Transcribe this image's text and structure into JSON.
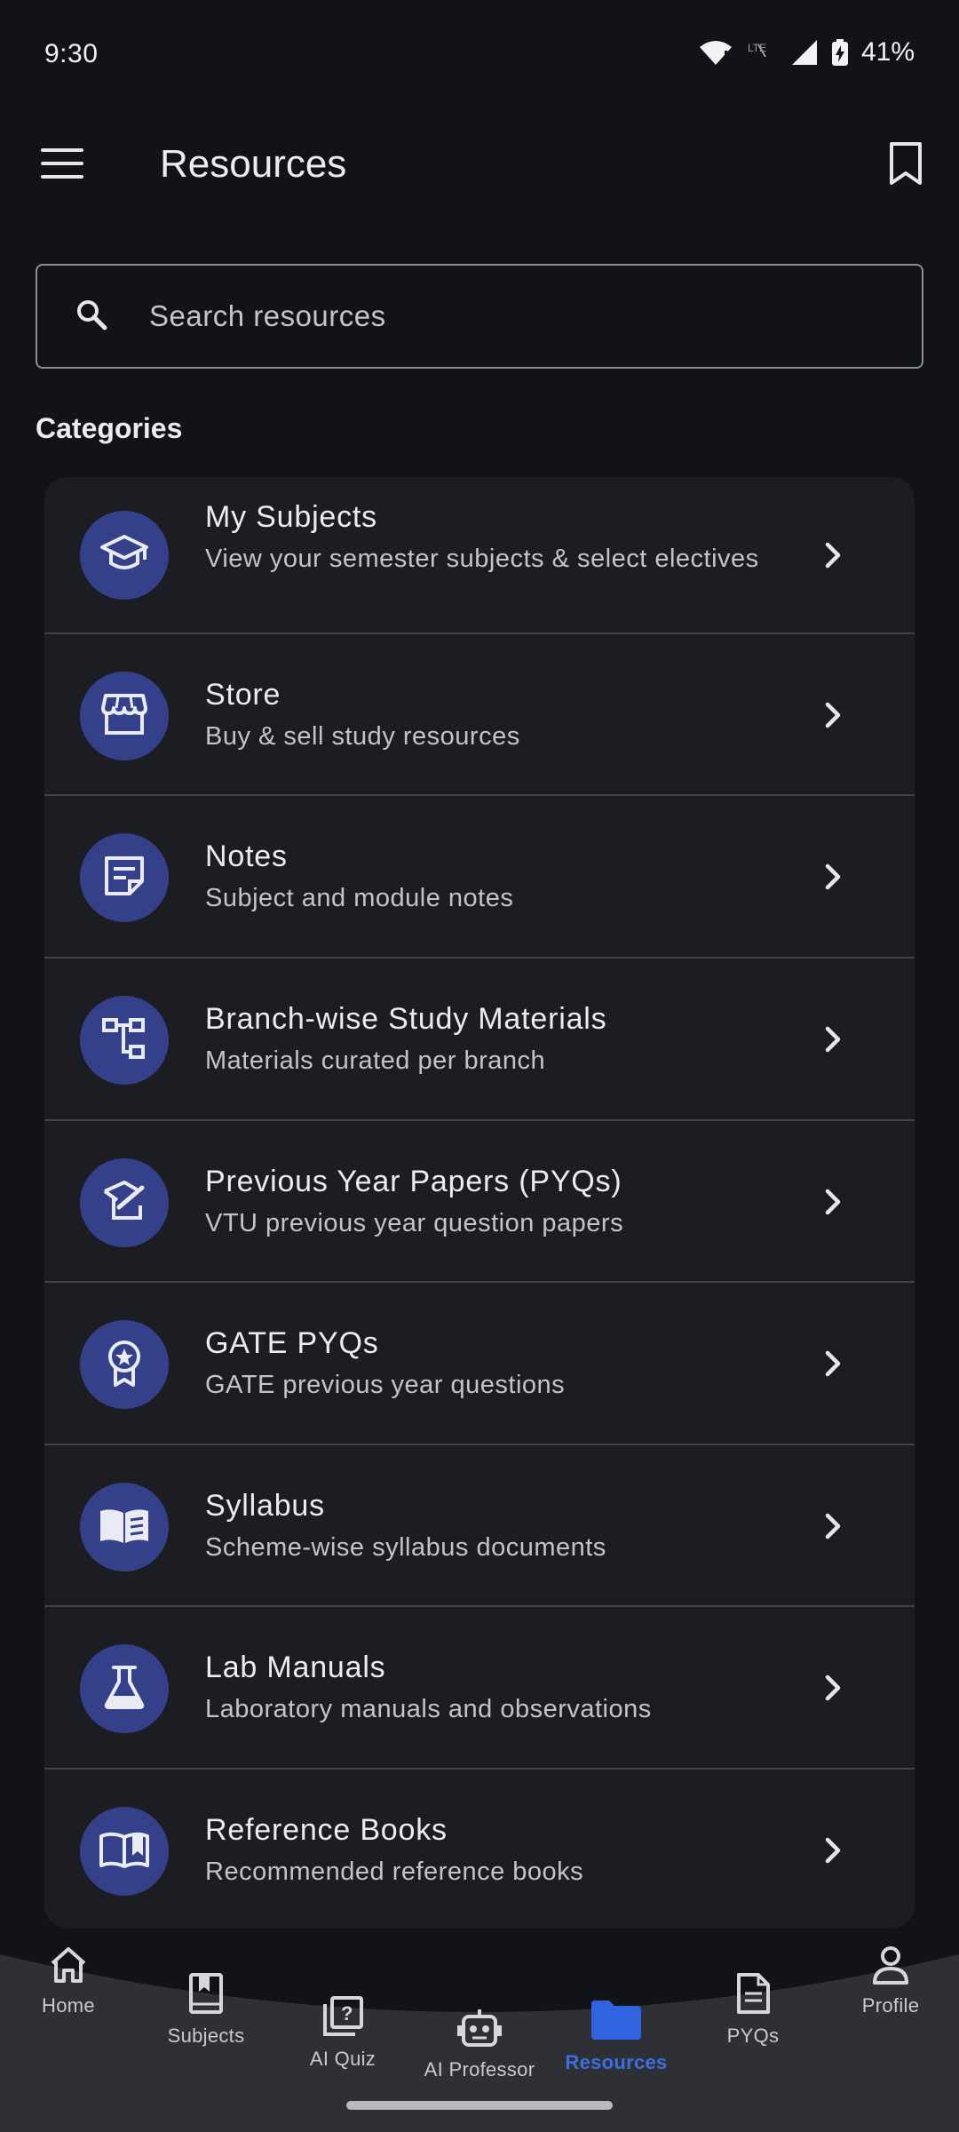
{
  "status_bar": {
    "time": "9:30",
    "battery": "41%",
    "icons": [
      "wifi-icon",
      "lte-icon",
      "signal-icon",
      "battery-charging-icon"
    ]
  },
  "app_bar": {
    "title": "Resources",
    "icons": [
      "menu-icon",
      "bookmark-icon"
    ]
  },
  "search": {
    "placeholder": "Search resources",
    "value": ""
  },
  "categories_heading": "Categories",
  "categories": [
    {
      "title": "My Subjects",
      "subtitle": "View your semester subjects & select electives",
      "icon": "graduation-cap-icon"
    },
    {
      "title": "Store",
      "subtitle": "Buy & sell study resources",
      "icon": "storefront-icon"
    },
    {
      "title": "Notes",
      "subtitle": "Subject and module notes",
      "icon": "sticky-note-icon"
    },
    {
      "title": "Branch-wise Study Materials",
      "subtitle": "Materials curated per branch",
      "icon": "account-tree-icon"
    },
    {
      "title": "Previous Year Papers (PYQs)",
      "subtitle": "VTU previous year question papers",
      "icon": "history-edu-icon"
    },
    {
      "title": "GATE PYQs",
      "subtitle": "GATE previous year questions",
      "icon": "award-badge-icon"
    },
    {
      "title": "Syllabus",
      "subtitle": "Scheme-wise syllabus documents",
      "icon": "open-book-icon"
    },
    {
      "title": "Lab Manuals",
      "subtitle": "Laboratory manuals and observations",
      "icon": "flask-icon"
    },
    {
      "title": "Reference Books",
      "subtitle": "Recommended reference books",
      "icon": "reference-book-icon"
    }
  ],
  "bottom_nav": {
    "active": "Resources",
    "items": [
      {
        "label": "Home",
        "icon": "home-icon"
      },
      {
        "label": "Subjects",
        "icon": "book-bookmark-icon"
      },
      {
        "label": "AI Quiz",
        "icon": "quiz-icon"
      },
      {
        "label": "AI Professor",
        "icon": "robot-icon"
      },
      {
        "label": "Resources",
        "icon": "folder-icon"
      },
      {
        "label": "PYQs",
        "icon": "document-icon"
      },
      {
        "label": "Profile",
        "icon": "person-icon"
      }
    ]
  },
  "colors": {
    "background": "#111318",
    "card": "#1c1d22",
    "avatar": "#34418a",
    "accent": "#3b6fe0",
    "nav_bar": "#2f3036"
  }
}
